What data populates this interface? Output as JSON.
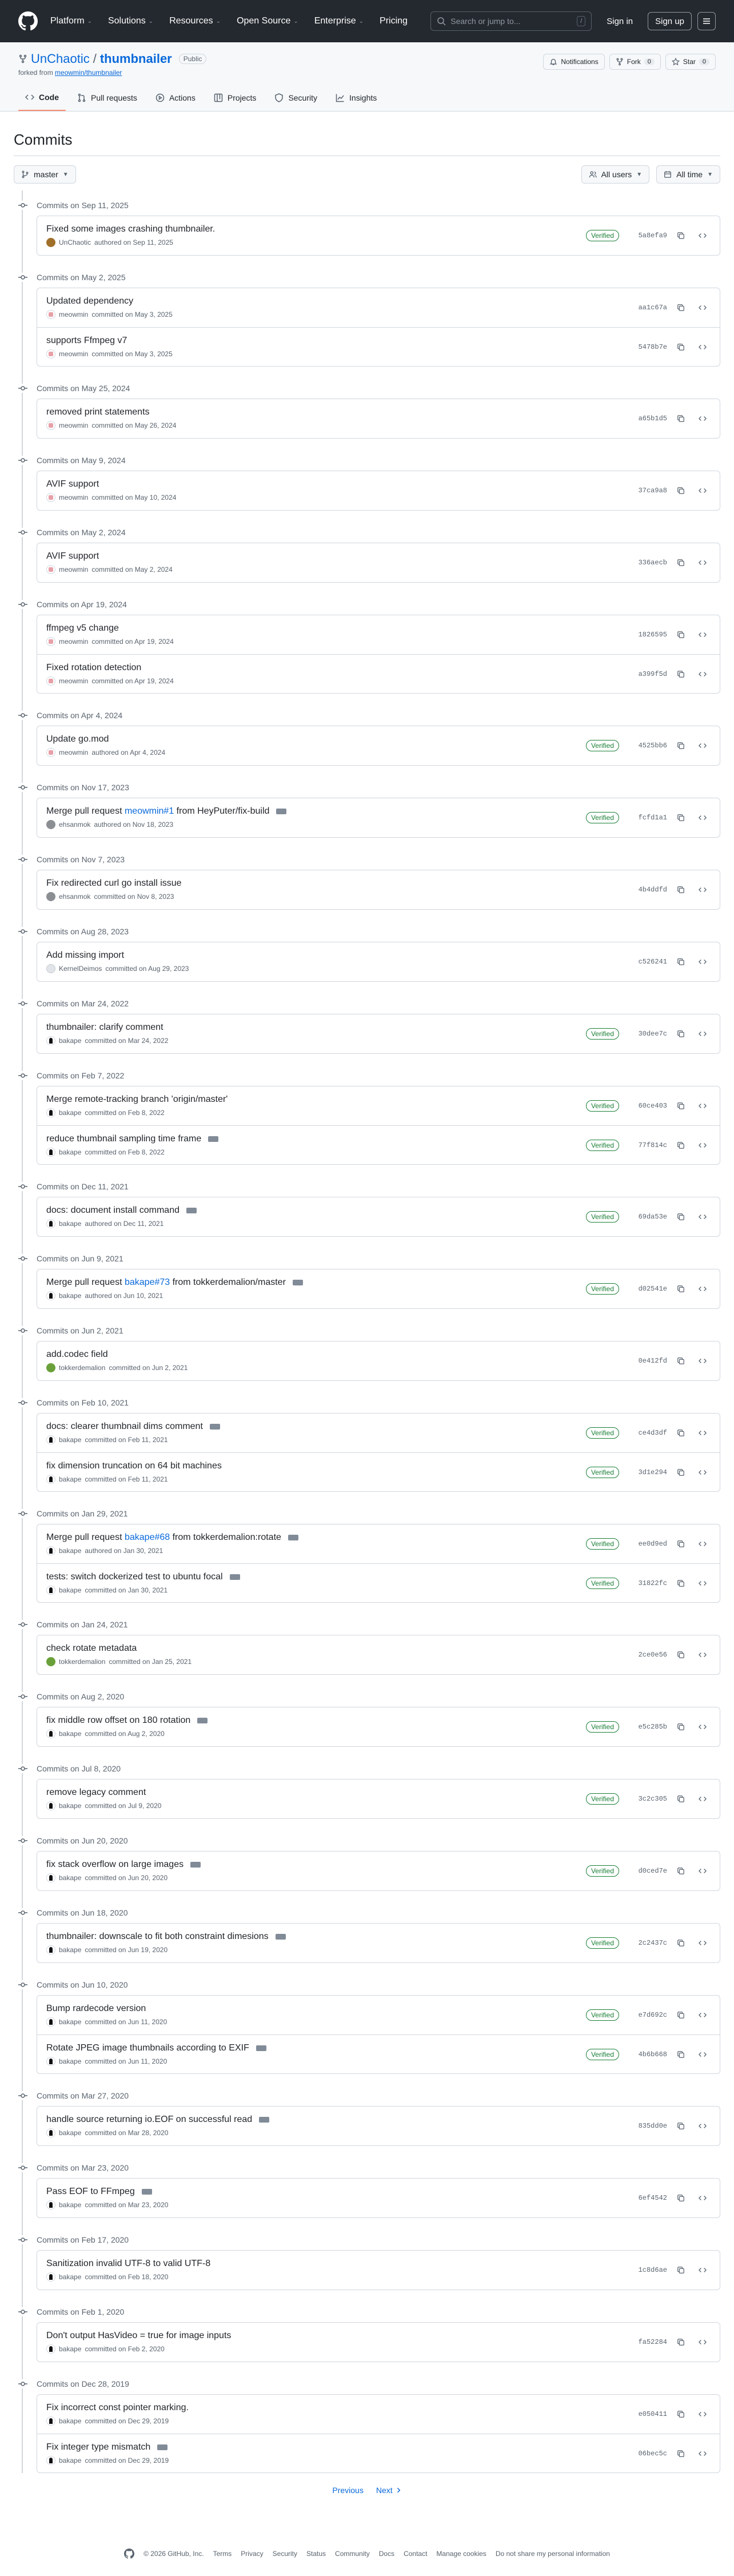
{
  "header": {
    "nav": [
      "Platform",
      "Solutions",
      "Resources",
      "Open Source",
      "Enterprise",
      "Pricing"
    ],
    "search_placeholder": "Search or jump to...",
    "search_kbd": "/",
    "signin": "Sign in",
    "signup": "Sign up"
  },
  "repo": {
    "owner": "UnChaotic",
    "sep": "/",
    "name": "thumbnailer",
    "visibility": "Public",
    "forked_prefix": "forked from",
    "forked_from": "meowmin/thumbnailer",
    "notifications": "Notifications",
    "fork_label": "Fork",
    "fork_count": "0",
    "star_label": "Star",
    "star_count": "0"
  },
  "tabs": [
    {
      "label": "Code",
      "icon": "code-icon"
    },
    {
      "label": "Pull requests",
      "icon": "pull-request-icon"
    },
    {
      "label": "Actions",
      "icon": "actions-icon"
    },
    {
      "label": "Projects",
      "icon": "projects-icon"
    },
    {
      "label": "Security",
      "icon": "shield-icon"
    },
    {
      "label": "Insights",
      "icon": "graph-icon"
    }
  ],
  "page_title": "Commits",
  "filters": {
    "branch": "master",
    "users": "All users",
    "time": "All time"
  },
  "groups": [
    {
      "date": "Commits on Sep 11, 2025",
      "commits": [
        {
          "msg": "Fixed some images crashing thumbnailer.",
          "author": "UnChaotic",
          "action": "authored on Sep 11, 2025",
          "avatar": "uc",
          "verified": true,
          "sha": "5a8efa9"
        }
      ]
    },
    {
      "date": "Commits on May 2, 2025",
      "commits": [
        {
          "msg": "Updated dependency",
          "author": "meowmin",
          "action": "committed on May 3, 2025",
          "avatar": "mw",
          "verified": false,
          "sha": "aa1c67a"
        },
        {
          "msg": "supports Ffmpeg v7",
          "author": "meowmin",
          "action": "committed on May 3, 2025",
          "avatar": "mw",
          "verified": false,
          "sha": "5478b7e"
        }
      ]
    },
    {
      "date": "Commits on May 25, 2024",
      "commits": [
        {
          "msg": "removed print statements",
          "author": "meowmin",
          "action": "committed on May 26, 2024",
          "avatar": "mw",
          "verified": false,
          "sha": "a65b1d5"
        }
      ]
    },
    {
      "date": "Commits on May 9, 2024",
      "commits": [
        {
          "msg": "AVIF support",
          "author": "meowmin",
          "action": "committed on May 10, 2024",
          "avatar": "mw",
          "verified": false,
          "sha": "37ca9a8"
        }
      ]
    },
    {
      "date": "Commits on May 2, 2024",
      "commits": [
        {
          "msg": "AVIF support",
          "author": "meowmin",
          "action": "committed on May 2, 2024",
          "avatar": "mw",
          "verified": false,
          "sha": "336aecb"
        }
      ]
    },
    {
      "date": "Commits on Apr 19, 2024",
      "commits": [
        {
          "msg": "ffmpeg v5 change",
          "author": "meowmin",
          "action": "committed on Apr 19, 2024",
          "avatar": "mw",
          "verified": false,
          "sha": "1826595"
        },
        {
          "msg": "Fixed rotation detection",
          "author": "meowmin",
          "action": "committed on Apr 19, 2024",
          "avatar": "mw",
          "verified": false,
          "sha": "a399f5d"
        }
      ]
    },
    {
      "date": "Commits on Apr 4, 2024",
      "commits": [
        {
          "msg": "Update go.mod",
          "author": "meowmin",
          "action": "authored on Apr 4, 2024",
          "avatar": "mw",
          "verified": true,
          "sha": "4525bb6"
        }
      ]
    },
    {
      "date": "Commits on Nov 17, 2023",
      "commits": [
        {
          "msg": "Merge pull request ",
          "link": "meowmin#1",
          "msg_after": " from HeyPuter/fix-build",
          "ellipsis": true,
          "author": "ehsanmok",
          "action": "authored on Nov 18, 2023",
          "avatar": "eh",
          "verified": true,
          "sha": "fcfd1a1"
        }
      ]
    },
    {
      "date": "Commits on Nov 7, 2023",
      "commits": [
        {
          "msg": "Fix redirected curl go install issue",
          "author": "ehsanmok",
          "action": "committed on Nov 8, 2023",
          "avatar": "eh",
          "verified": false,
          "sha": "4b4ddfd"
        }
      ]
    },
    {
      "date": "Commits on Aug 28, 2023",
      "commits": [
        {
          "msg": "Add missing import",
          "author": "KernelDeimos",
          "action": "committed on Aug 29, 2023",
          "avatar": "kd",
          "verified": false,
          "sha": "c526241"
        }
      ]
    },
    {
      "date": "Commits on Mar 24, 2022",
      "commits": [
        {
          "msg": "thumbnailer: clarify comment",
          "author": "bakape",
          "action": "committed on Mar 24, 2022",
          "avatar": "bk",
          "verified": true,
          "sha": "30dee7c"
        }
      ]
    },
    {
      "date": "Commits on Feb 7, 2022",
      "commits": [
        {
          "msg": "Merge remote-tracking branch 'origin/master'",
          "author": "bakape",
          "action": "committed on Feb 8, 2022",
          "avatar": "bk",
          "verified": true,
          "sha": "60ce403"
        },
        {
          "msg": "reduce thumbnail sampling time frame",
          "ellipsis": true,
          "author": "bakape",
          "action": "committed on Feb 8, 2022",
          "avatar": "bk",
          "verified": true,
          "sha": "77f814c"
        }
      ]
    },
    {
      "date": "Commits on Dec 11, 2021",
      "commits": [
        {
          "msg": "docs: document install command",
          "ellipsis": true,
          "author": "bakape",
          "action": "authored on Dec 11, 2021",
          "avatar": "bk",
          "verified": true,
          "sha": "69da53e"
        }
      ]
    },
    {
      "date": "Commits on Jun 9, 2021",
      "commits": [
        {
          "msg": "Merge pull request ",
          "link": "bakape#73",
          "msg_after": " from tokkerdemalion/master",
          "ellipsis": true,
          "author": "bakape",
          "action": "authored on Jun 10, 2021",
          "avatar": "bk",
          "verified": true,
          "sha": "d02541e"
        }
      ]
    },
    {
      "date": "Commits on Jun 2, 2021",
      "commits": [
        {
          "msg": "add.codec field",
          "author": "tokkerdemalion",
          "action": "committed on Jun 2, 2021",
          "avatar": "tk",
          "verified": false,
          "sha": "0e412fd"
        }
      ]
    },
    {
      "date": "Commits on Feb 10, 2021",
      "commits": [
        {
          "msg": "docs: clearer thumbnail dims comment",
          "ellipsis": true,
          "author": "bakape",
          "action": "committed on Feb 11, 2021",
          "avatar": "bk",
          "verified": true,
          "sha": "ce4d3df"
        },
        {
          "msg": "fix dimension truncation on 64 bit machines",
          "author": "bakape",
          "action": "committed on Feb 11, 2021",
          "avatar": "bk",
          "verified": true,
          "sha": "3d1e294"
        }
      ]
    },
    {
      "date": "Commits on Jan 29, 2021",
      "commits": [
        {
          "msg": "Merge pull request ",
          "link": "bakape#68",
          "msg_after": " from tokkerdemalion:rotate",
          "ellipsis": true,
          "author": "bakape",
          "action": "authored on Jan 30, 2021",
          "avatar": "bk",
          "verified": true,
          "sha": "ee0d9ed"
        },
        {
          "msg": "tests: switch dockerized test to ubuntu focal",
          "ellipsis": true,
          "author": "bakape",
          "action": "committed on Jan 30, 2021",
          "avatar": "bk",
          "verified": true,
          "sha": "31822fc"
        }
      ]
    },
    {
      "date": "Commits on Jan 24, 2021",
      "commits": [
        {
          "msg": "check rotate metadata",
          "author": "tokkerdemalion",
          "action": "committed on Jan 25, 2021",
          "avatar": "tk",
          "verified": false,
          "sha": "2ce0e56"
        }
      ]
    },
    {
      "date": "Commits on Aug 2, 2020",
      "commits": [
        {
          "msg": "fix middle row offset on 180 rotation",
          "ellipsis": true,
          "author": "bakape",
          "action": "committed on Aug 2, 2020",
          "avatar": "bk",
          "verified": true,
          "sha": "e5c285b"
        }
      ]
    },
    {
      "date": "Commits on Jul 8, 2020",
      "commits": [
        {
          "msg": "remove legacy comment",
          "author": "bakape",
          "action": "committed on Jul 9, 2020",
          "avatar": "bk",
          "verified": true,
          "sha": "3c2c305"
        }
      ]
    },
    {
      "date": "Commits on Jun 20, 2020",
      "commits": [
        {
          "msg": "fix stack overflow on large images",
          "ellipsis": true,
          "author": "bakape",
          "action": "committed on Jun 20, 2020",
          "avatar": "bk",
          "verified": true,
          "sha": "d0ced7e"
        }
      ]
    },
    {
      "date": "Commits on Jun 18, 2020",
      "commits": [
        {
          "msg": "thumbnailer: downscale to fit both constraint dimesions",
          "ellipsis": true,
          "author": "bakape",
          "action": "committed on Jun 19, 2020",
          "avatar": "bk",
          "verified": true,
          "sha": "2c2437c"
        }
      ]
    },
    {
      "date": "Commits on Jun 10, 2020",
      "commits": [
        {
          "msg": "Bump rardecode version",
          "author": "bakape",
          "action": "committed on Jun 11, 2020",
          "avatar": "bk",
          "verified": true,
          "sha": "e7d692c"
        },
        {
          "msg": "Rotate JPEG image thumbnails according to EXIF",
          "ellipsis": true,
          "author": "bakape",
          "action": "committed on Jun 11, 2020",
          "avatar": "bk",
          "verified": true,
          "sha": "4b6b668"
        }
      ]
    },
    {
      "date": "Commits on Mar 27, 2020",
      "commits": [
        {
          "msg": "handle source returning io.EOF on successful read",
          "ellipsis": true,
          "author": "bakape",
          "action": "committed on Mar 28, 2020",
          "avatar": "bk",
          "verified": false,
          "sha": "835dd0e"
        }
      ]
    },
    {
      "date": "Commits on Mar 23, 2020",
      "commits": [
        {
          "msg": "Pass EOF to FFmpeg",
          "ellipsis": true,
          "author": "bakape",
          "action": "committed on Mar 23, 2020",
          "avatar": "bk",
          "verified": false,
          "sha": "6ef4542"
        }
      ]
    },
    {
      "date": "Commits on Feb 17, 2020",
      "commits": [
        {
          "msg": "Sanitization invalid UTF-8 to valid UTF-8",
          "author": "bakape",
          "action": "committed on Feb 18, 2020",
          "avatar": "bk",
          "verified": false,
          "sha": "1c8d6ae"
        }
      ]
    },
    {
      "date": "Commits on Feb 1, 2020",
      "commits": [
        {
          "msg": "Don't output HasVideo = true for image inputs",
          "author": "bakape",
          "action": "committed on Feb 2, 2020",
          "avatar": "bk",
          "verified": false,
          "sha": "fa52284"
        }
      ]
    },
    {
      "date": "Commits on Dec 28, 2019",
      "commits": [
        {
          "msg": "Fix incorrect const pointer marking.",
          "author": "bakape",
          "action": "committed on Dec 29, 2019",
          "avatar": "bk",
          "verified": false,
          "sha": "e050411"
        },
        {
          "msg": "Fix integer type mismatch",
          "ellipsis": true,
          "author": "bakape",
          "action": "committed on Dec 29, 2019",
          "avatar": "bk",
          "verified": false,
          "sha": "06bec5c"
        }
      ]
    }
  ],
  "verified_label": "Verified",
  "pagination": {
    "prev": "Previous",
    "next": "Next"
  },
  "footer": [
    "© 2026 GitHub, Inc.",
    "Terms",
    "Privacy",
    "Security",
    "Status",
    "Community",
    "Docs",
    "Contact",
    "Manage cookies",
    "Do not share my personal information"
  ]
}
